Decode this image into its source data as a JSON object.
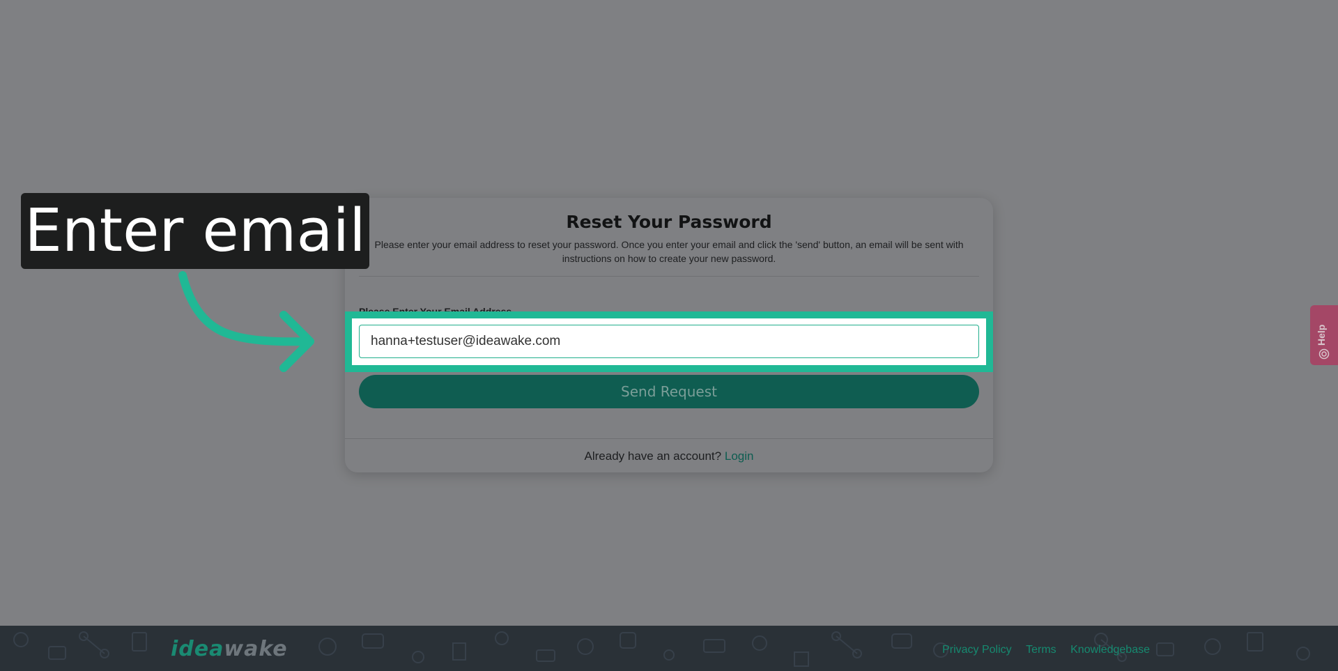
{
  "card": {
    "title": "Reset Your Password",
    "description": "Please enter your email address to reset your password. Once you enter your email and click the 'send' button, an email will be sent with instructions on how to create your new password.",
    "email_label": "Please Enter Your Email Address",
    "email_value": "hanna+testuser@ideawake.com",
    "send_button": "Send Request",
    "account_prompt": "Already have an account?",
    "login_link": "Login"
  },
  "annotation": {
    "text": "Enter email"
  },
  "help_tab": {
    "label": "Help"
  },
  "footer": {
    "logo_part1": "idea",
    "logo_part2": "wake",
    "links": [
      "Privacy Policy",
      "Terms",
      "Knowledgebase"
    ]
  },
  "colors": {
    "accent": "#20b895",
    "button": "#0f5d51",
    "help": "#a44766",
    "footer": "#2a3137"
  }
}
